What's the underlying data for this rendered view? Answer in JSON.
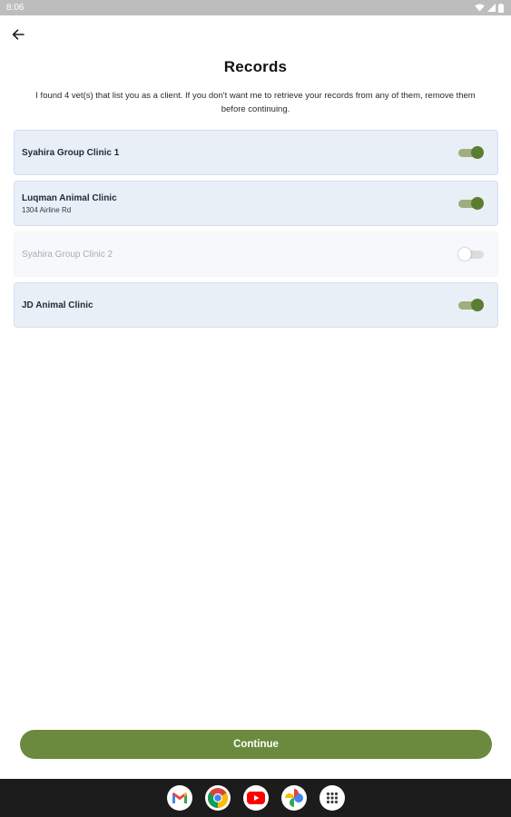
{
  "status_bar": {
    "time": "8:06",
    "icons": [
      "wifi-icon",
      "signal-icon",
      "battery-icon"
    ]
  },
  "header": {
    "back_icon": "arrow-left-icon",
    "title": "Records"
  },
  "intro": {
    "text": "I found 4 vet(s) that list you as a client. If you don't want me to retrieve your records from any of them, remove them before continuing."
  },
  "clinics": [
    {
      "name": "Syahira Group Clinic 1",
      "address": "",
      "enabled": true
    },
    {
      "name": "Luqman Animal Clinic",
      "address": "1304 Airline Rd",
      "enabled": true
    },
    {
      "name": "Syahira Group Clinic 2",
      "address": "",
      "enabled": false
    },
    {
      "name": "JD Animal Clinic",
      "address": "",
      "enabled": true
    }
  ],
  "footer": {
    "continue_label": "Continue"
  },
  "dock": {
    "apps": [
      "gmail-icon",
      "chrome-icon",
      "youtube-icon",
      "photos-icon",
      "app-drawer-icon"
    ]
  },
  "colors": {
    "accent": "#6b8a3e",
    "toggle_on_thumb": "#5b7d2f",
    "toggle_on_track": "#9fae7c",
    "card_background": "#e9eff7",
    "status_bar": "#bdbdbd",
    "nav_bar": "#1c1c1c"
  }
}
